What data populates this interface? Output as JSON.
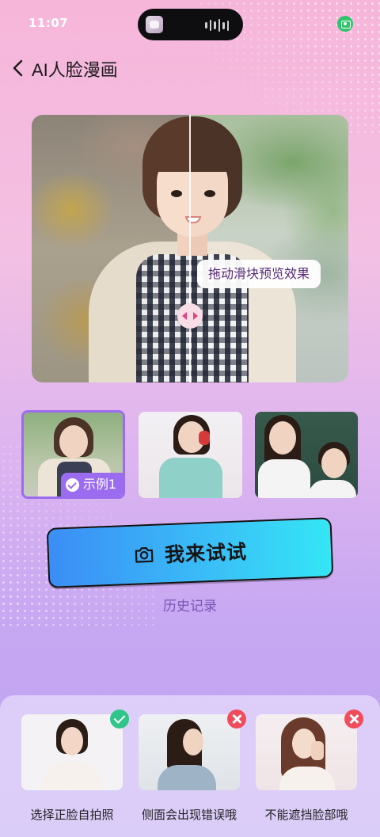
{
  "status_bar": {
    "time": "11:07"
  },
  "header": {
    "title": "AI人脸漫画"
  },
  "preview": {
    "tooltip": "拖动滑块预览效果"
  },
  "samples": {
    "selected_badge": "示例1",
    "items": [
      {
        "name": "sample-1",
        "selected": true
      },
      {
        "name": "sample-2",
        "selected": false
      },
      {
        "name": "sample-3",
        "selected": false
      }
    ]
  },
  "actions": {
    "try_label": "我来试试",
    "history_label": "历史记录"
  },
  "guide": {
    "items": [
      {
        "caption": "选择正脸自拍照",
        "status": "ok"
      },
      {
        "caption": "侧面会出现错误哦",
        "status": "no"
      },
      {
        "caption": "不能遮挡脸部哦",
        "status": "no"
      }
    ]
  },
  "colors": {
    "accent": "#9b6cf0",
    "button_gradient_start": "#3b8df5",
    "button_gradient_end": "#34e6f5",
    "ok": "#2fc58b",
    "error": "#f04c5c"
  }
}
